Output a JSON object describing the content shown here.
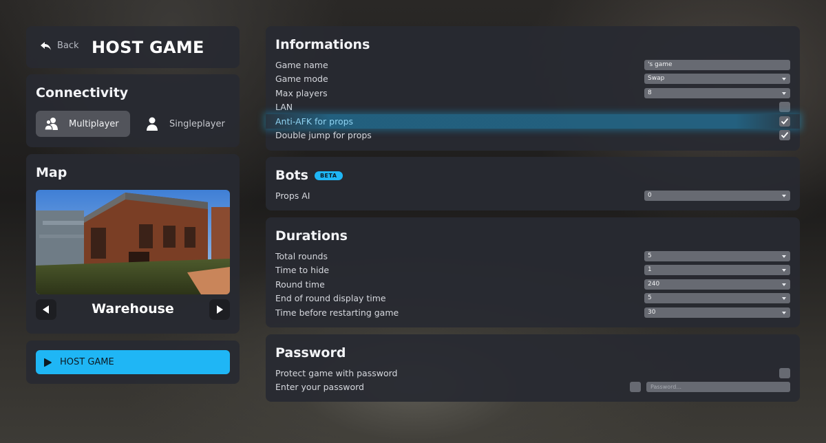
{
  "header": {
    "back_label": "Back",
    "title": "HOST GAME"
  },
  "connectivity": {
    "title": "Connectivity",
    "options": [
      {
        "label": "Multiplayer",
        "icon": "multiplayer-icon",
        "selected": true
      },
      {
        "label": "Singleplayer",
        "icon": "user-icon",
        "selected": false
      }
    ]
  },
  "map": {
    "title": "Map",
    "name": "Warehouse"
  },
  "host_button": {
    "label": "HOST GAME"
  },
  "informations": {
    "title": "Informations",
    "game_name": {
      "label": "Game name",
      "value": "'s game"
    },
    "game_mode": {
      "label": "Game mode",
      "value": "Swap"
    },
    "max_players": {
      "label": "Max players",
      "value": "8"
    },
    "lan": {
      "label": "LAN",
      "checked": false
    },
    "anti_afk": {
      "label": "Anti-AFK for props",
      "checked": true
    },
    "double_jump": {
      "label": "Double jump for props",
      "checked": true
    }
  },
  "bots": {
    "title": "Bots",
    "badge": "BETA",
    "props_ai": {
      "label": "Props AI",
      "value": "0"
    }
  },
  "durations": {
    "title": "Durations",
    "total_rounds": {
      "label": "Total rounds",
      "value": "5"
    },
    "time_to_hide": {
      "label": "Time to hide",
      "value": "1"
    },
    "round_time": {
      "label": "Round time",
      "value": "240"
    },
    "end_display": {
      "label": "End of round display time",
      "value": "5"
    },
    "restart_time": {
      "label": "Time before restarting game",
      "value": "30"
    }
  },
  "password": {
    "title": "Password",
    "protect": {
      "label": "Protect game with password",
      "checked": false
    },
    "enter": {
      "label": "Enter your password",
      "placeholder": "Password..."
    }
  },
  "colors": {
    "accent": "#1fb6f5",
    "panel": "#282a31",
    "field": "#676a72"
  }
}
